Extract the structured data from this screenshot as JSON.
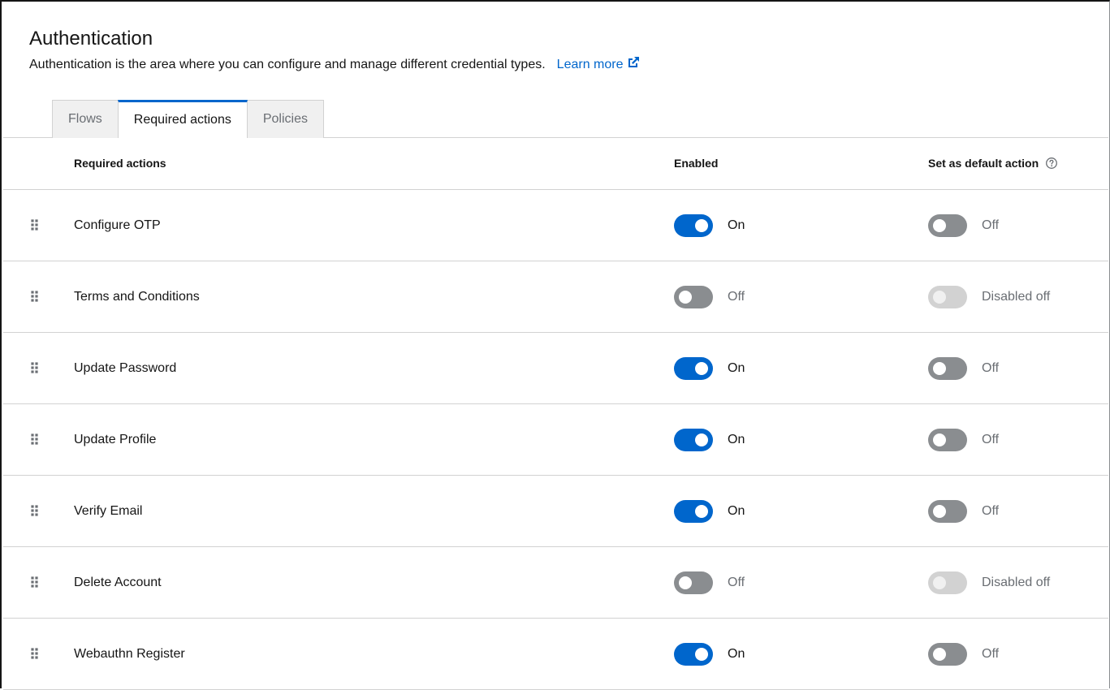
{
  "header": {
    "title": "Authentication",
    "description": "Authentication is the area where you can configure and manage different credential types.",
    "learn_more": "Learn more",
    "learn_more_icon": "external-link-icon"
  },
  "tabs": [
    {
      "label": "Flows",
      "active": false
    },
    {
      "label": "Required actions",
      "active": true
    },
    {
      "label": "Policies",
      "active": false
    }
  ],
  "table": {
    "headers": {
      "name": "Required actions",
      "enabled": "Enabled",
      "default": "Set as default action",
      "default_icon": "help-icon"
    },
    "drag_icon": "drag-handle-icon",
    "rows": [
      {
        "name": "Configure OTP",
        "enabled": {
          "state": "on",
          "label": "On"
        },
        "default": {
          "state": "off",
          "label": "Off"
        }
      },
      {
        "name": "Terms and Conditions",
        "enabled": {
          "state": "off",
          "label": "Off"
        },
        "default": {
          "state": "disabled",
          "label": "Disabled off"
        }
      },
      {
        "name": "Update Password",
        "enabled": {
          "state": "on",
          "label": "On"
        },
        "default": {
          "state": "off",
          "label": "Off"
        }
      },
      {
        "name": "Update Profile",
        "enabled": {
          "state": "on",
          "label": "On"
        },
        "default": {
          "state": "off",
          "label": "Off"
        }
      },
      {
        "name": "Verify Email",
        "enabled": {
          "state": "on",
          "label": "On"
        },
        "default": {
          "state": "off",
          "label": "Off"
        }
      },
      {
        "name": "Delete Account",
        "enabled": {
          "state": "off",
          "label": "Off"
        },
        "default": {
          "state": "disabled",
          "label": "Disabled off"
        }
      },
      {
        "name": "Webauthn Register",
        "enabled": {
          "state": "on",
          "label": "On"
        },
        "default": {
          "state": "off",
          "label": "Off"
        }
      }
    ]
  },
  "colors": {
    "accent": "#0066cc",
    "toggle_off": "#8a8d90",
    "toggle_disabled": "#d2d2d2",
    "text": "#151515",
    "muted_text": "#6a6e73"
  }
}
